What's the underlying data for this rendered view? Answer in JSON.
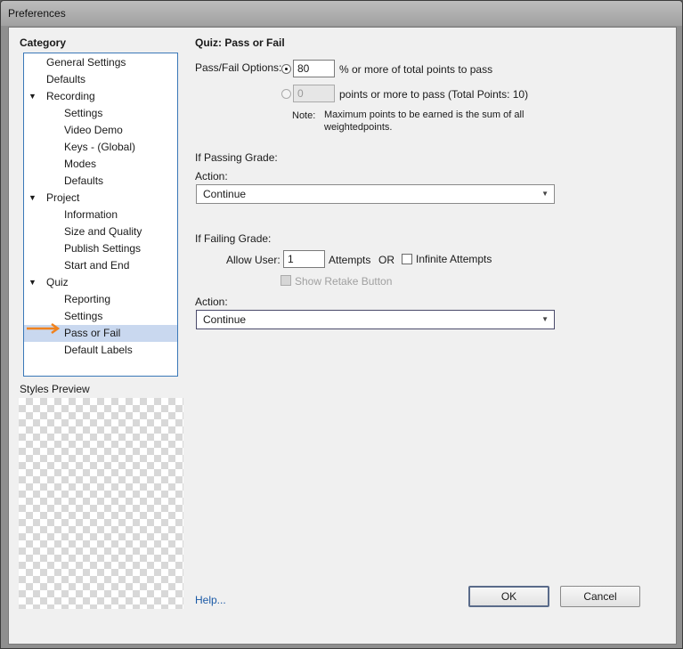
{
  "window": {
    "title": "Preferences"
  },
  "category": {
    "heading": "Category",
    "items": [
      {
        "label": "General Settings",
        "level": 0,
        "expandable": false
      },
      {
        "label": "Defaults",
        "level": 0,
        "expandable": false
      },
      {
        "label": "Recording",
        "level": 0,
        "expandable": true
      },
      {
        "label": "Settings",
        "level": 1,
        "expandable": false
      },
      {
        "label": "Video Demo",
        "level": 1,
        "expandable": false
      },
      {
        "label": "Keys - (Global)",
        "level": 1,
        "expandable": false
      },
      {
        "label": "Modes",
        "level": 1,
        "expandable": false
      },
      {
        "label": "Defaults",
        "level": 1,
        "expandable": false
      },
      {
        "label": "Project",
        "level": 0,
        "expandable": true
      },
      {
        "label": "Information",
        "level": 1,
        "expandable": false
      },
      {
        "label": "Size and Quality",
        "level": 1,
        "expandable": false
      },
      {
        "label": "Publish Settings",
        "level": 1,
        "expandable": false
      },
      {
        "label": "Start and End",
        "level": 1,
        "expandable": false
      },
      {
        "label": "Quiz",
        "level": 0,
        "expandable": true
      },
      {
        "label": "Reporting",
        "level": 1,
        "expandable": false
      },
      {
        "label": "Settings",
        "level": 1,
        "expandable": false
      },
      {
        "label": "Pass or Fail",
        "level": 1,
        "expandable": false,
        "selected": true
      },
      {
        "label": "Default Labels",
        "level": 1,
        "expandable": false
      }
    ],
    "expand_glyph": "▼"
  },
  "styles_preview": {
    "label": "Styles Preview"
  },
  "panel": {
    "title": "Quiz: Pass or Fail",
    "pass_fail_label": "Pass/Fail Options:",
    "percent_value": "80",
    "percent_text": "% or more of total points to pass",
    "points_value": "0",
    "points_text": "points or more to pass (Total Points: 10)",
    "note_label": "Note:",
    "note_line1": "Maximum points to be earned is the sum of all",
    "note_line2": "weightedpoints.",
    "passing_heading": "If Passing Grade:",
    "passing_action_label": "Action:",
    "passing_action_value": "Continue",
    "failing_heading": "If Failing Grade:",
    "allow_user_label": "Allow User:",
    "attempts_value": "1",
    "attempts_label": "Attempts",
    "or_label": "OR",
    "infinite_label": "Infinite Attempts",
    "show_retake_label": "Show Retake Button",
    "failing_action_label": "Action:",
    "failing_action_value": "Continue"
  },
  "footer": {
    "help_label": "Help...",
    "ok_label": "OK",
    "cancel_label": "Cancel"
  },
  "colors": {
    "selection": "#c9d8ef",
    "tree_border": "#3a78b8",
    "link": "#1b5aa6",
    "arrow": "#f0821e"
  }
}
